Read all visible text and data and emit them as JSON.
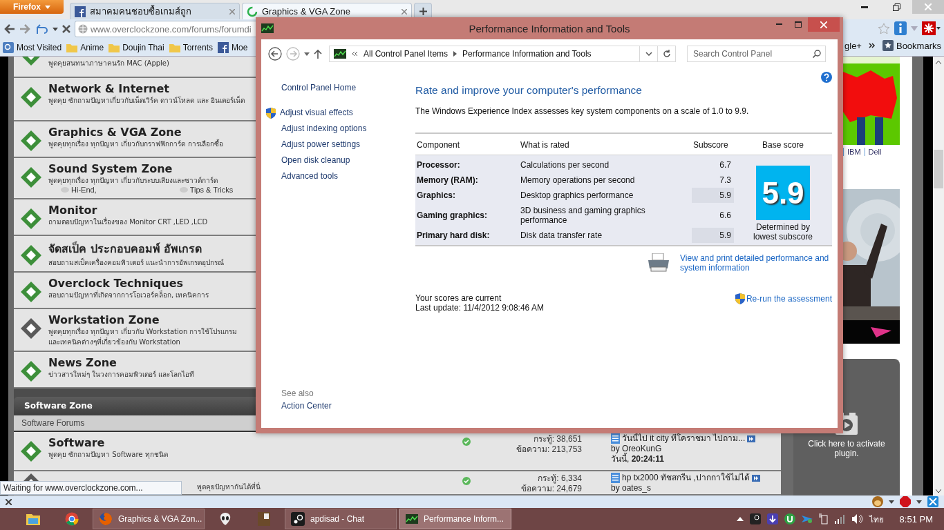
{
  "browser": {
    "menu_button": "Firefox",
    "tabs": [
      {
        "title": "สมาคมคนชอบซื้อเกมส์ถูก",
        "kind": "facebook",
        "selected": false
      },
      {
        "title": "Graphics & VGA Zone",
        "kind": "loading",
        "selected": true
      }
    ],
    "url": "www.overclockzone.com/forums/forumdi",
    "bookmarks": [
      {
        "label": "Most Visited",
        "kind": "places"
      },
      {
        "label": "Anime",
        "kind": "folder"
      },
      {
        "label": "Doujin Thai",
        "kind": "folder"
      },
      {
        "label": "Torrents",
        "kind": "folder"
      },
      {
        "label": "Moe",
        "kind": "facebook"
      }
    ],
    "bookmarks_tail": "gle+",
    "bookmarks_menu": "Bookmarks"
  },
  "forum": {
    "rows": [
      {
        "description": "พูดคุยสนทนาภาษาคนรัก MAC (Apple)",
        "color": "#3d8f3a",
        "kind": "cut_top"
      },
      {
        "title": "Network & Internet",
        "description": "พูดคุย ซักถามปัญหาเกี่ยวกับเน็ตเวิร์ค ดาวน์โหลด และ อินเตอร์เน็ต",
        "color": "#3d8f3a"
      },
      {
        "title": "Graphics & VGA Zone",
        "description": "พูดคุยทุกเรื่อง ทุกปัญหา เกี่ยวกับกราฟฟิกการ์ด การเลือกซื้อ",
        "color": "#3d8f3a"
      },
      {
        "title": "Sound System Zone",
        "description": "พูดคุยทุกเรื่อง ทุกปัญหา เกี่ยวกับระบบเสียงและซาวด์การ์ด",
        "subforums": [
          "Hi-End,",
          "Tips & Tricks"
        ],
        "color": "#3d8f3a"
      },
      {
        "title": "Monitor",
        "description": "ถามตอบปัญหาในเรื่องของ Monitor CRT ,LED ,LCD",
        "color": "#3d8f3a"
      },
      {
        "title": "จัดสเป็ค ประกอบคอมพ์ อัพเกรด",
        "description": "สอบถามสเป็คเครื่องคอมพิวเตอร์ แนะนำการอัพเกรดอุปกรณ์",
        "color": "#3d8f3a"
      },
      {
        "title": "Overclock Techniques",
        "description": "สอบถามปัญหาที่เกิดจากการโอเวอร์คล็อก, เทคนิคการ",
        "color": "#3d8f3a"
      },
      {
        "title": "Workstation Zone",
        "description": "พูดคุยทุกเรื่อง ทุกปัญหา เกี่ยวกับ Workstation การใช้โปรแกรม",
        "description_2": "และเทคนิคต่างๆที่เกี่ยวข้องกับ Workstation",
        "color": "#5a5a5a"
      },
      {
        "title": "News Zone",
        "description": "ข่าวสารใหม่ๆ ในวงการคอมพิวเตอร์ และโลกไอที",
        "color": "#3d8f3a"
      }
    ],
    "section": {
      "title": "Software Zone",
      "subtitle": "Software Forums"
    },
    "section_rows": [
      {
        "title": "Software",
        "description": "พูดคุย ซักถามปัญหา Software ทุกชนิด",
        "color": "#3d8f3a",
        "threads": "กระทู้: 38,651",
        "posts": "ข้อความ: 213,753",
        "last_post": "วันนี้ไป it city ที่โคราชมา ไปถาม...",
        "last_by": "by OreoKunG",
        "last_time": "วันนี้, **20:24:11**"
      },
      {
        "description": "พูดคุยปัญหากันได้ที่นี่",
        "color": "#5a5a5a",
        "kind": "cut_bottom",
        "threads": "กระทู้: 6,334",
        "posts": "ข้อความ: 24,679",
        "last_post": "hp tx2000 ทัชสกรีน ,ปากกาใช้ไม่ได้",
        "last_by": "by oates_s"
      }
    ]
  },
  "sidebar": {
    "links": [
      "IBM",
      "Dell"
    ],
    "plugin": "Click here to activate plugin."
  },
  "status": "Waiting for www.overclockzone.com...",
  "dialog": {
    "title": "Performance Information and Tools",
    "breadcrumb": [
      "All Control Panel Items",
      "Performance Information and Tools"
    ],
    "search_placeholder": "Search Control Panel",
    "home_link": "Control Panel Home",
    "tasks": [
      {
        "label": "Adjust visual effects",
        "shield": true
      },
      {
        "label": "Adjust indexing options",
        "shield": false
      },
      {
        "label": "Adjust power settings",
        "shield": false
      },
      {
        "label": "Open disk cleanup",
        "shield": false
      },
      {
        "label": "Advanced tools",
        "shield": false
      }
    ],
    "see_also": "See also",
    "see_also_links": [
      "Action Center"
    ],
    "heading": "Rate and improve your computer's performance",
    "intro": "The Windows Experience Index assesses key system components on a scale of 1.0 to 9.9.",
    "columns": [
      "Component",
      "What is rated",
      "Subscore",
      "Base score"
    ],
    "rows": [
      {
        "component": "Processor:",
        "rated": "Calculations per second",
        "subscore": "6.7",
        "lowest": false
      },
      {
        "component": "Memory (RAM):",
        "rated": "Memory operations per second",
        "subscore": "7.3",
        "lowest": false
      },
      {
        "component": "Graphics:",
        "rated": "Desktop graphics performance",
        "subscore": "5.9",
        "lowest": true
      },
      {
        "component": "Gaming graphics:",
        "rated": "3D business and gaming graphics performance",
        "subscore": "6.6",
        "lowest": false
      },
      {
        "component": "Primary hard disk:",
        "rated": "Disk data transfer rate",
        "subscore": "5.9",
        "lowest": true
      }
    ],
    "base_score": "5.9",
    "base_note": "Determined by lowest subscore",
    "print_link": "View and print detailed performance and system information",
    "scores_status": "Your scores are current",
    "last_update": "Last update: 11/4/2012 9:08:46 AM",
    "rerun_link": "Re-run the assessment"
  },
  "taskbar": {
    "items": [
      {
        "label": "Graphics & VGA Zon...",
        "kind": "firefox",
        "selected": false
      },
      {
        "label": "apdisad - Chat",
        "kind": "steam",
        "selected": false
      },
      {
        "label": "Performance Inform...",
        "kind": "monitor",
        "selected": true
      }
    ],
    "language": "ไทย",
    "clock": "8:51 PM"
  }
}
